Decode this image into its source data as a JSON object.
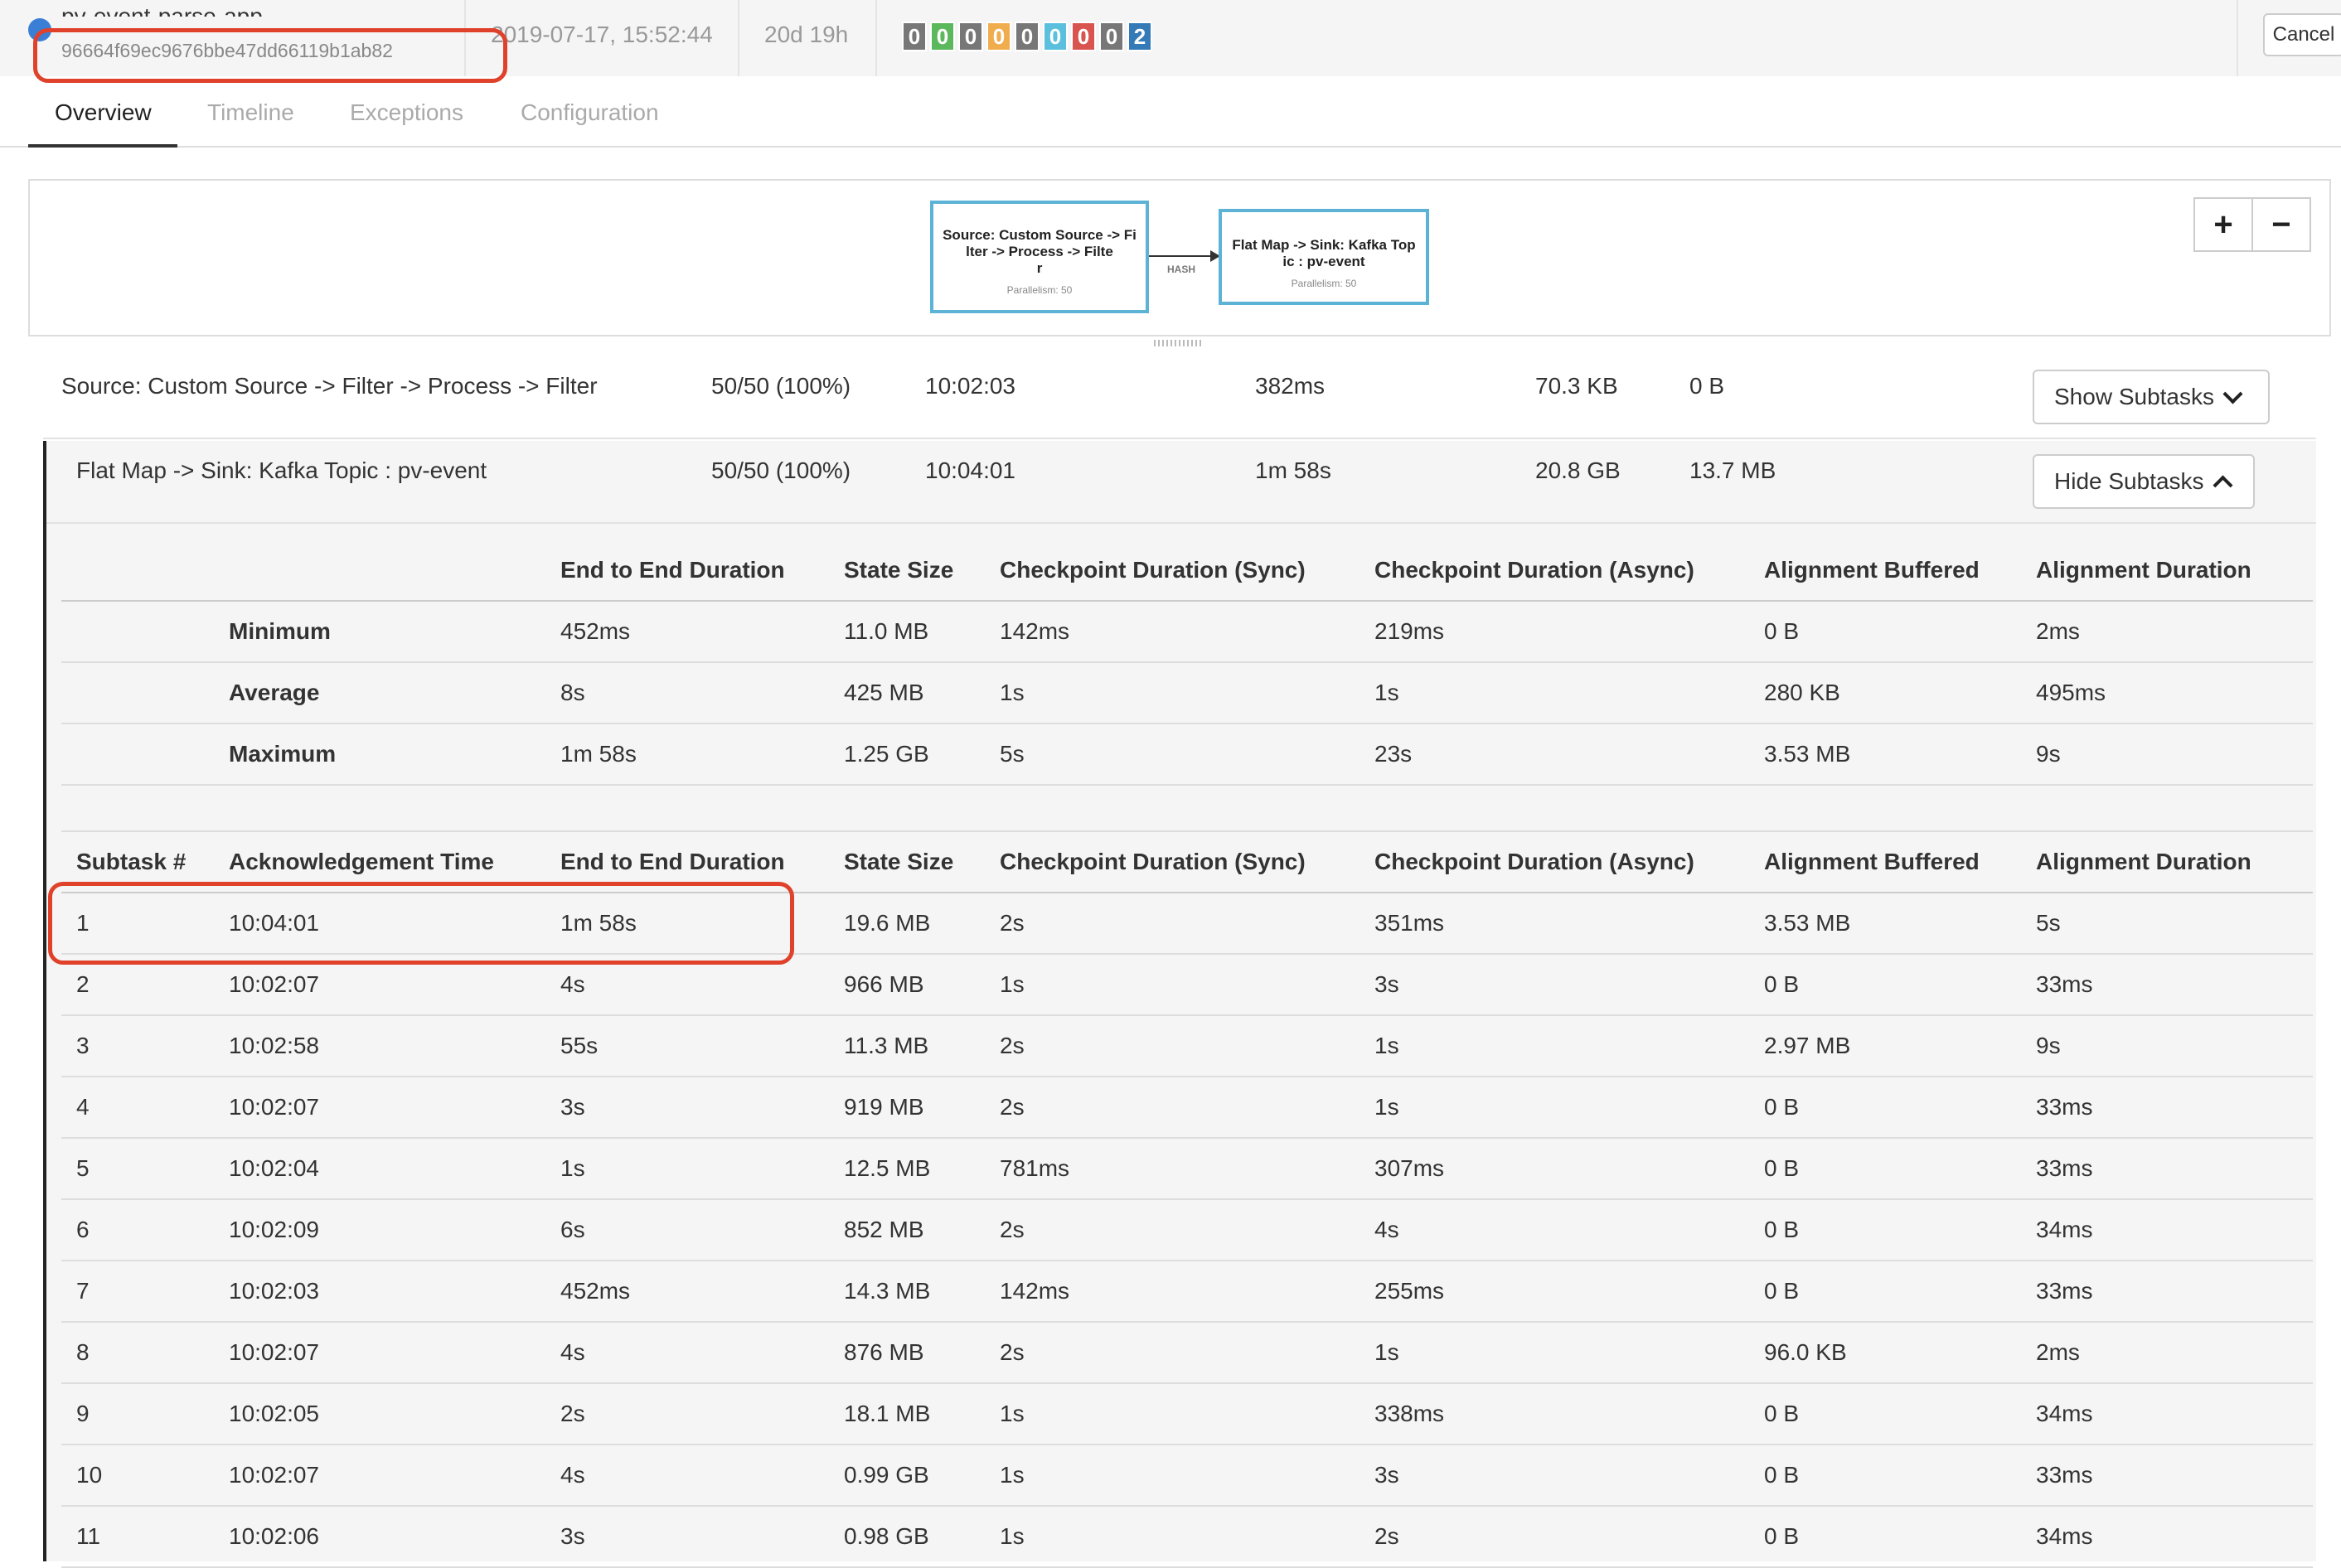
{
  "header": {
    "job_name": "pv-event-parse-app",
    "job_id": "96664f69ec9676bbe47dd66119b1ab82",
    "start_time": "2019-07-17, 15:52:44",
    "duration": "20d 19h",
    "status_counts": [
      {
        "value": "0",
        "color": "#777777"
      },
      {
        "value": "0",
        "color": "#5cb85c"
      },
      {
        "value": "0",
        "color": "#777777"
      },
      {
        "value": "0",
        "color": "#f0ad4e"
      },
      {
        "value": "0",
        "color": "#777777"
      },
      {
        "value": "0",
        "color": "#5bc0de"
      },
      {
        "value": "0",
        "color": "#d9534f"
      },
      {
        "value": "0",
        "color": "#777777"
      },
      {
        "value": "2",
        "color": "#337ab7"
      }
    ],
    "cancel_label": "Cancel"
  },
  "tabs": [
    {
      "label": "Overview",
      "active": true
    },
    {
      "label": "Timeline",
      "active": false
    },
    {
      "label": "Exceptions",
      "active": false
    },
    {
      "label": "Configuration",
      "active": false
    }
  ],
  "graph": {
    "source_node_label": "Source: Custom Source -> Fi lter -> Process -> Filte r",
    "source_node_line1": "Source: Custom Source -> Fi",
    "source_node_line2": "lter -> Process -> Filte",
    "source_node_line3": "r",
    "source_parallelism": "Parallelism: 50",
    "sink_node_line1": "Flat Map -> Sink: Kafka Top",
    "sink_node_line2": "ic : pv-event",
    "sink_parallelism": "Parallelism: 50",
    "edge_label": "HASH",
    "zoom_in": "+",
    "zoom_out": "−"
  },
  "vertices": [
    {
      "name": "Source: Custom Source -> Filter -> Process -> Filter",
      "acknowledged": "50/50 (100%)",
      "latest_ack": "10:02:03",
      "duration": "382ms",
      "state_size": "70.3 KB",
      "buffered": "0 B",
      "button": "Show Subtasks"
    },
    {
      "name": "Flat Map -> Sink: Kafka Topic : pv-event",
      "acknowledged": "50/50 (100%)",
      "latest_ack": "10:04:01",
      "duration": "1m 58s",
      "state_size": "20.8 GB",
      "buffered": "13.7 MB",
      "button": "Hide Subtasks"
    }
  ],
  "summary": {
    "headers": [
      "End to End Duration",
      "State Size",
      "Checkpoint Duration (Sync)",
      "Checkpoint Duration (Async)",
      "Alignment Buffered",
      "Alignment Duration"
    ],
    "rows": [
      {
        "label": "Minimum",
        "values": [
          "452ms",
          "11.0 MB",
          "142ms",
          "219ms",
          "0 B",
          "2ms"
        ]
      },
      {
        "label": "Average",
        "values": [
          "8s",
          "425 MB",
          "1s",
          "1s",
          "280 KB",
          "495ms"
        ]
      },
      {
        "label": "Maximum",
        "values": [
          "1m 58s",
          "1.25 GB",
          "5s",
          "23s",
          "3.53 MB",
          "9s"
        ]
      }
    ]
  },
  "subtasks": {
    "headers": [
      "Subtask #",
      "Acknowledgement Time",
      "End to End Duration",
      "State Size",
      "Checkpoint Duration (Sync)",
      "Checkpoint Duration (Async)",
      "Alignment Buffered",
      "Alignment Duration"
    ],
    "rows": [
      [
        "1",
        "10:04:01",
        "1m 58s",
        "19.6 MB",
        "2s",
        "351ms",
        "3.53 MB",
        "5s"
      ],
      [
        "2",
        "10:02:07",
        "4s",
        "966 MB",
        "1s",
        "3s",
        "0 B",
        "33ms"
      ],
      [
        "3",
        "10:02:58",
        "55s",
        "11.3 MB",
        "2s",
        "1s",
        "2.97 MB",
        "9s"
      ],
      [
        "4",
        "10:02:07",
        "3s",
        "919 MB",
        "2s",
        "1s",
        "0 B",
        "33ms"
      ],
      [
        "5",
        "10:02:04",
        "1s",
        "12.5 MB",
        "781ms",
        "307ms",
        "0 B",
        "33ms"
      ],
      [
        "6",
        "10:02:09",
        "6s",
        "852 MB",
        "2s",
        "4s",
        "0 B",
        "34ms"
      ],
      [
        "7",
        "10:02:03",
        "452ms",
        "14.3 MB",
        "142ms",
        "255ms",
        "0 B",
        "33ms"
      ],
      [
        "8",
        "10:02:07",
        "4s",
        "876 MB",
        "2s",
        "1s",
        "96.0 KB",
        "2ms"
      ],
      [
        "9",
        "10:02:05",
        "2s",
        "18.1 MB",
        "1s",
        "338ms",
        "0 B",
        "34ms"
      ],
      [
        "10",
        "10:02:07",
        "4s",
        "0.99 GB",
        "1s",
        "3s",
        "0 B",
        "33ms"
      ],
      [
        "11",
        "10:02:06",
        "3s",
        "0.98 GB",
        "1s",
        "2s",
        "0 B",
        "34ms"
      ]
    ]
  },
  "colors": {
    "accent": "#5cb3d6",
    "annotation": "#e0412b"
  }
}
